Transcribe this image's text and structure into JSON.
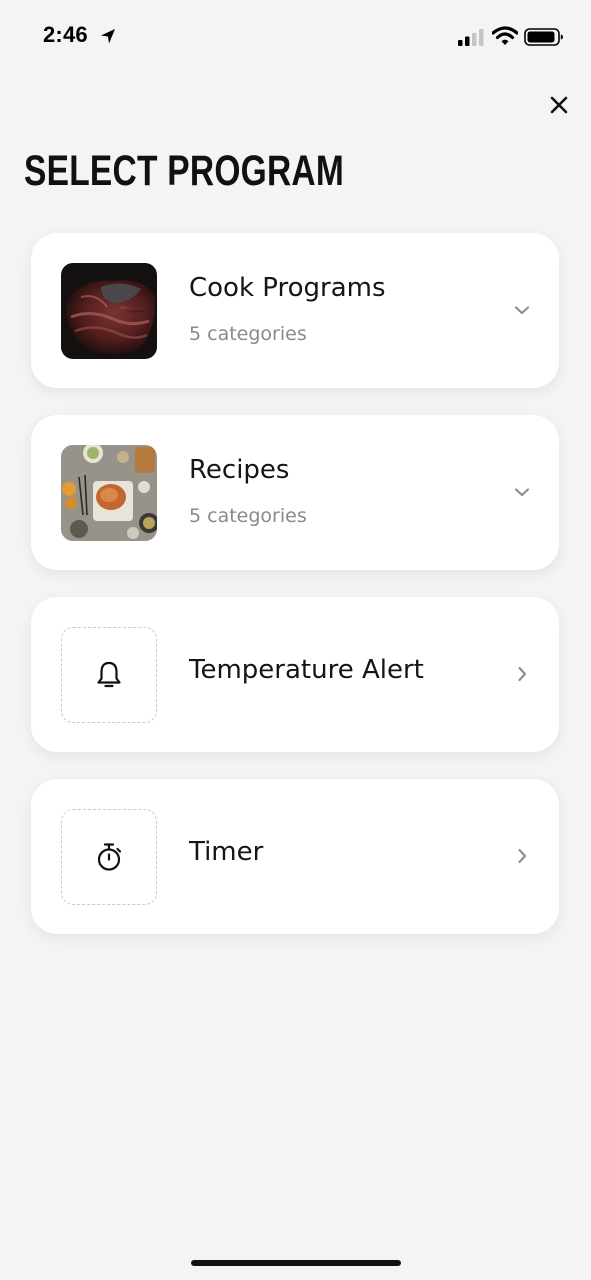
{
  "status_bar": {
    "time": "2:46"
  },
  "header": {
    "title": "SELECT PROGRAM"
  },
  "programs": [
    {
      "title": "Cook Programs",
      "subtitle": "5 categories",
      "chevron": "chevron-down-icon",
      "thumb": "cook-programs-image"
    },
    {
      "title": "Recipes",
      "subtitle": "5 categories",
      "chevron": "chevron-down-icon",
      "thumb": "recipes-image"
    },
    {
      "title": "Temperature Alert",
      "chevron": "chevron-right-icon",
      "thumb": "bell-icon"
    },
    {
      "title": "Timer",
      "chevron": "chevron-right-icon",
      "thumb": "stopwatch-icon"
    }
  ],
  "colors": {
    "background": "#f4f4f4",
    "card": "#ffffff",
    "subtitle": "#8a8a8a",
    "chevron": "#8e8e8e"
  }
}
